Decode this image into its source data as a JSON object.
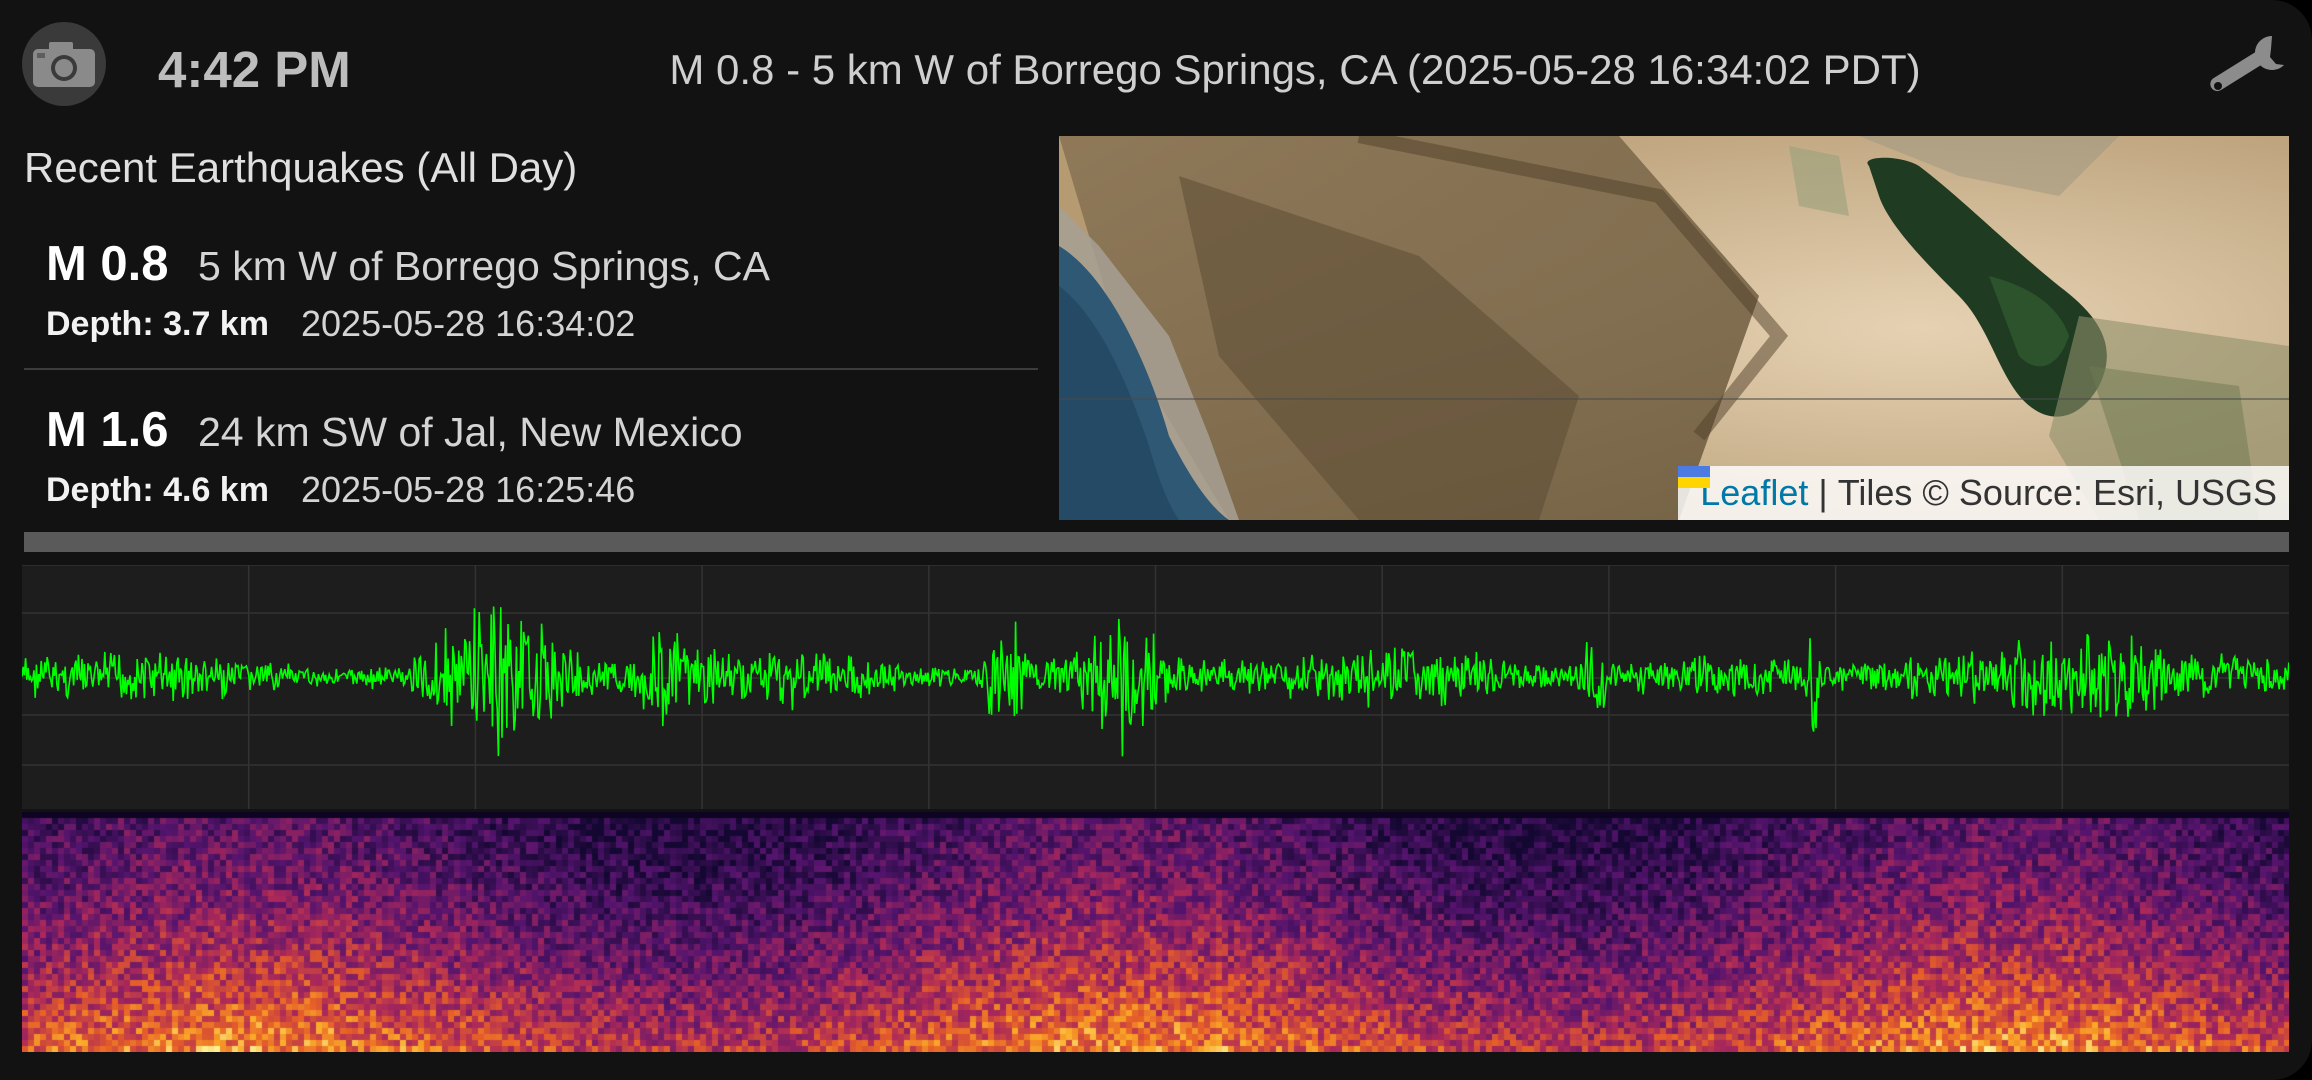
{
  "header": {
    "time": "4:42 PM",
    "event_title": "M 0.8 - 5 km W of Borrego Springs, CA (2025-05-28 16:34:02 PDT)",
    "camera_icon": "camera-icon",
    "settings_icon": "wrench-icon"
  },
  "quake_list": {
    "title": "Recent Earthquakes (All Day)",
    "items": [
      {
        "magnitude": "M 0.8",
        "place": "5 km W of Borrego Springs, CA",
        "depth": "Depth: 3.7 km",
        "time": "2025-05-28 16:34:02"
      },
      {
        "magnitude": "M 1.6",
        "place": "24 km SW of Jal, New Mexico",
        "depth": "Depth: 4.6 km",
        "time": "2025-05-28 16:25:46"
      }
    ]
  },
  "map": {
    "attribution_link": "Leaflet",
    "attribution_separator": "|",
    "attribution_tiles": "Tiles © Source: Esri, USGS",
    "flag_icon": "ukraine-flag-icon"
  },
  "colors": {
    "waveform": "#00ff00",
    "background": "#121212",
    "link": "#0078a8"
  }
}
